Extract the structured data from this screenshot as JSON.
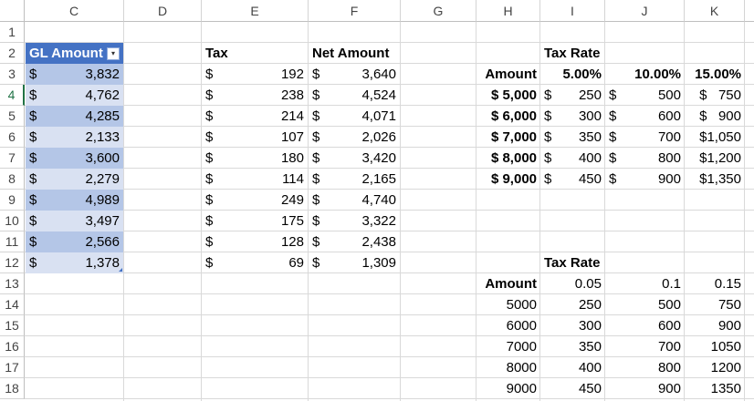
{
  "columns": [
    "C",
    "D",
    "E",
    "F",
    "G",
    "H",
    "I",
    "J",
    "K"
  ],
  "rows": [
    "1",
    "2",
    "3",
    "4",
    "5",
    "6",
    "7",
    "8",
    "9",
    "10",
    "11",
    "12",
    "13",
    "14",
    "15",
    "16",
    "17",
    "18"
  ],
  "table": {
    "header": "GL Amount",
    "filter_icon": "▾",
    "currency": "$",
    "values": [
      "3,832",
      "4,762",
      "4,285",
      "2,133",
      "3,600",
      "2,279",
      "4,989",
      "3,497",
      "2,566",
      "1,378"
    ]
  },
  "tax": {
    "header": "Tax",
    "currency": "$",
    "values": [
      "192",
      "238",
      "214",
      "107",
      "180",
      "114",
      "249",
      "175",
      "128",
      "69"
    ]
  },
  "net": {
    "header": "Net Amount",
    "currency": "$",
    "values": [
      "3,640",
      "4,524",
      "4,071",
      "2,026",
      "3,420",
      "2,165",
      "4,740",
      "3,322",
      "2,438",
      "1,309"
    ]
  },
  "rate_table1": {
    "title": "Tax Rate",
    "amount_label": "Amount",
    "rates": [
      "5.00%",
      "10.00%",
      "15.00%"
    ],
    "currency": "$",
    "amounts": [
      "$ 5,000",
      "$ 6,000",
      "$ 7,000",
      "$ 8,000",
      "$ 9,000"
    ],
    "col_i": [
      "250",
      "300",
      "350",
      "400",
      "450"
    ],
    "col_j": [
      "500",
      "600",
      "700",
      "800",
      "900"
    ],
    "col_k": [
      "$   750",
      "$   900",
      "$1,050",
      "$1,200",
      "$1,350"
    ]
  },
  "rate_table2": {
    "title": "Tax Rate",
    "amount_label": "Amount",
    "rates": [
      "0.05",
      "0.1",
      "0.15"
    ],
    "amounts": [
      "5000",
      "6000",
      "7000",
      "8000",
      "9000"
    ],
    "col_i": [
      "250",
      "300",
      "350",
      "400",
      "450"
    ],
    "col_j": [
      "500",
      "600",
      "700",
      "800",
      "900"
    ],
    "col_k": [
      "750",
      "900",
      "1050",
      "1200",
      "1350"
    ]
  },
  "selected_row": "4"
}
